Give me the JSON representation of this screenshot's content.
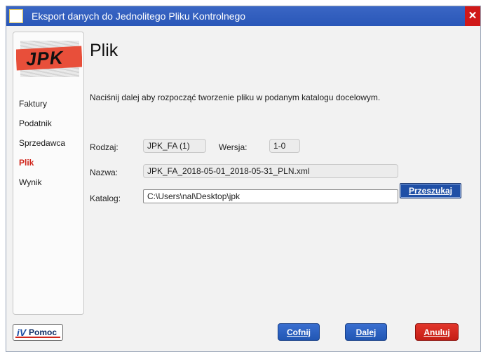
{
  "window": {
    "title": "Eksport danych do Jednolitego Pliku Kontrolnego",
    "close_glyph": "✕"
  },
  "sidebar": {
    "logo_text": "JPK",
    "items": [
      {
        "label": "Faktury",
        "active": false
      },
      {
        "label": "Podatnik",
        "active": false
      },
      {
        "label": "Sprzedawca",
        "active": false
      },
      {
        "label": "Plik",
        "active": true
      },
      {
        "label": "Wynik",
        "active": false
      }
    ]
  },
  "main": {
    "title": "Plik",
    "instruction": "Naciśnij dalej aby rozpocząć tworzenie pliku w podanym katalogu docelowym.",
    "rodzaj": {
      "label": "Rodzaj:",
      "value": "JPK_FA (1)"
    },
    "wersja": {
      "label": "Wersja:",
      "value": "1-0"
    },
    "nazwa": {
      "label": "Nazwa:",
      "value": "JPK_FA_2018-05-01_2018-05-31_PLN.xml"
    },
    "katalog": {
      "label": "Katalog:",
      "value": "C:\\Users\\nal\\Desktop\\jpk"
    },
    "browse_label": "Przeszukaj"
  },
  "footer": {
    "help_label": "Pomoc",
    "help_icon_glyph": "iV",
    "back_label": "Cofnij",
    "next_label": "Dalej",
    "cancel_label": "Anuluj"
  },
  "colors": {
    "titlebar": "#2a57b8",
    "active_nav": "#d0251b",
    "primary_button": "#2156b3",
    "cancel_button": "#c51d15"
  }
}
